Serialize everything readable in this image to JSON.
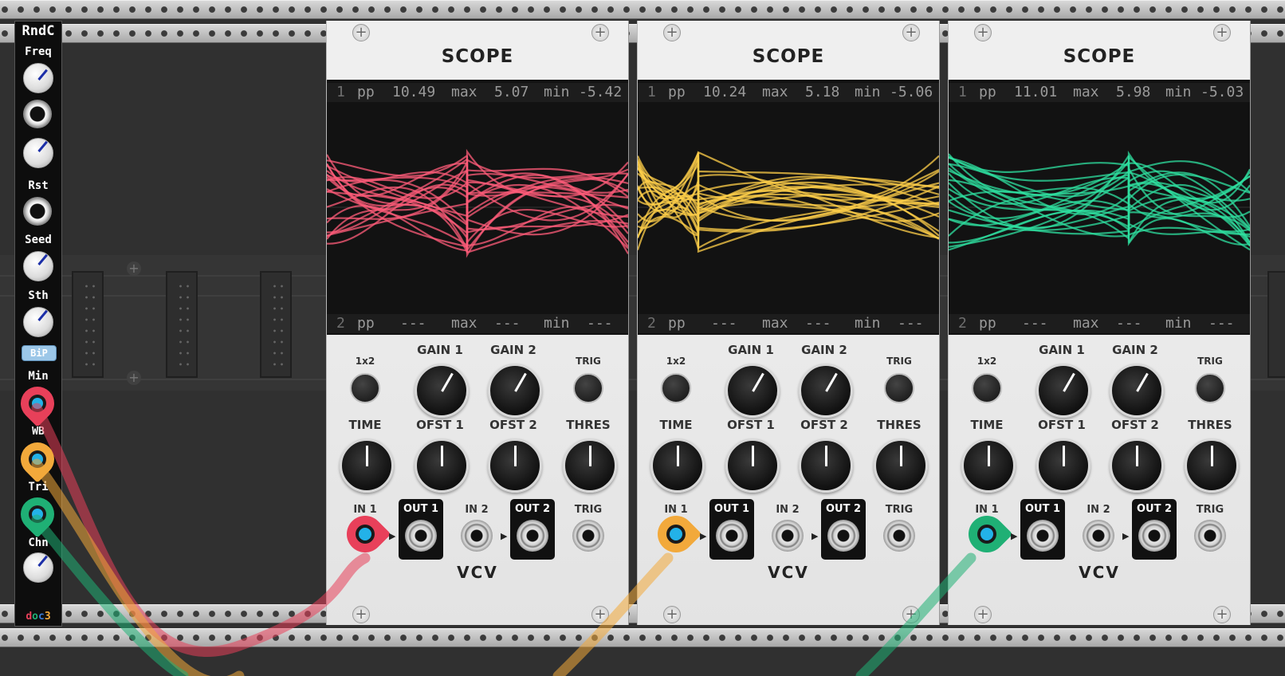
{
  "rndc": {
    "title": "RndC",
    "labels": {
      "freq": "Freq",
      "rst": "Rst",
      "seed": "Seed",
      "sth": "Sth",
      "min": "Min",
      "wb": "WB",
      "tri": "Tri",
      "chn": "Chn"
    },
    "bip_label": "BiP",
    "logo": "doc3"
  },
  "scopes": [
    {
      "name": "SCOPE",
      "trace_color": "#ff5c7a",
      "ch1": {
        "num": "1",
        "pp_label": "pp",
        "pp": "10.49",
        "max_label": "max",
        "max": "5.07",
        "min_label": "min",
        "min": "-5.42"
      },
      "ch2": {
        "num": "2",
        "pp_label": "pp",
        "pp": "---",
        "max_label": "max",
        "max": "---",
        "min_label": "min",
        "min": "---"
      },
      "controls": {
        "btn1x2": "1x2",
        "gain1": "GAIN 1",
        "gain2": "GAIN 2",
        "trig": "TRIG",
        "time": "TIME",
        "ofst1": "OFST 1",
        "ofst2": "OFST 2",
        "thres": "THRES",
        "in1": "IN 1",
        "out1": "OUT 1",
        "in2": "IN 2",
        "out2": "OUT 2",
        "trig_in": "TRIG",
        "logo": "VCV"
      },
      "plug_color": "#e8405a"
    },
    {
      "name": "SCOPE",
      "trace_color": "#ffcf4a",
      "ch1": {
        "num": "1",
        "pp_label": "pp",
        "pp": "10.24",
        "max_label": "max",
        "max": "5.18",
        "min_label": "min",
        "min": "-5.06"
      },
      "ch2": {
        "num": "2",
        "pp_label": "pp",
        "pp": "---",
        "max_label": "max",
        "max": "---",
        "min_label": "min",
        "min": "---"
      },
      "controls": {
        "btn1x2": "1x2",
        "gain1": "GAIN 1",
        "gain2": "GAIN 2",
        "trig": "TRIG",
        "time": "TIME",
        "ofst1": "OFST 1",
        "ofst2": "OFST 2",
        "thres": "THRES",
        "in1": "IN 1",
        "out1": "OUT 1",
        "in2": "IN 2",
        "out2": "OUT 2",
        "trig_in": "TRIG",
        "logo": "VCV"
      },
      "plug_color": "#f2a93b"
    },
    {
      "name": "SCOPE",
      "trace_color": "#2fe0a0",
      "ch1": {
        "num": "1",
        "pp_label": "pp",
        "pp": "11.01",
        "max_label": "max",
        "max": "5.98",
        "min_label": "min",
        "min": "-5.03"
      },
      "ch2": {
        "num": "2",
        "pp_label": "pp",
        "pp": "---",
        "max_label": "max",
        "max": "---",
        "min_label": "min",
        "min": "---"
      },
      "controls": {
        "btn1x2": "1x2",
        "gain1": "GAIN 1",
        "gain2": "GAIN 2",
        "trig": "TRIG",
        "time": "TIME",
        "ofst1": "OFST 1",
        "ofst2": "OFST 2",
        "thres": "THRES",
        "in1": "IN 1",
        "out1": "OUT 1",
        "in2": "IN 2",
        "out2": "OUT 2",
        "trig_in": "TRIG",
        "logo": "VCV"
      },
      "plug_color": "#1fb075"
    }
  ],
  "colors": {
    "red_cable": "#e8405a",
    "yellow_cable": "#f2a93b",
    "green_cable": "#1fb075"
  }
}
